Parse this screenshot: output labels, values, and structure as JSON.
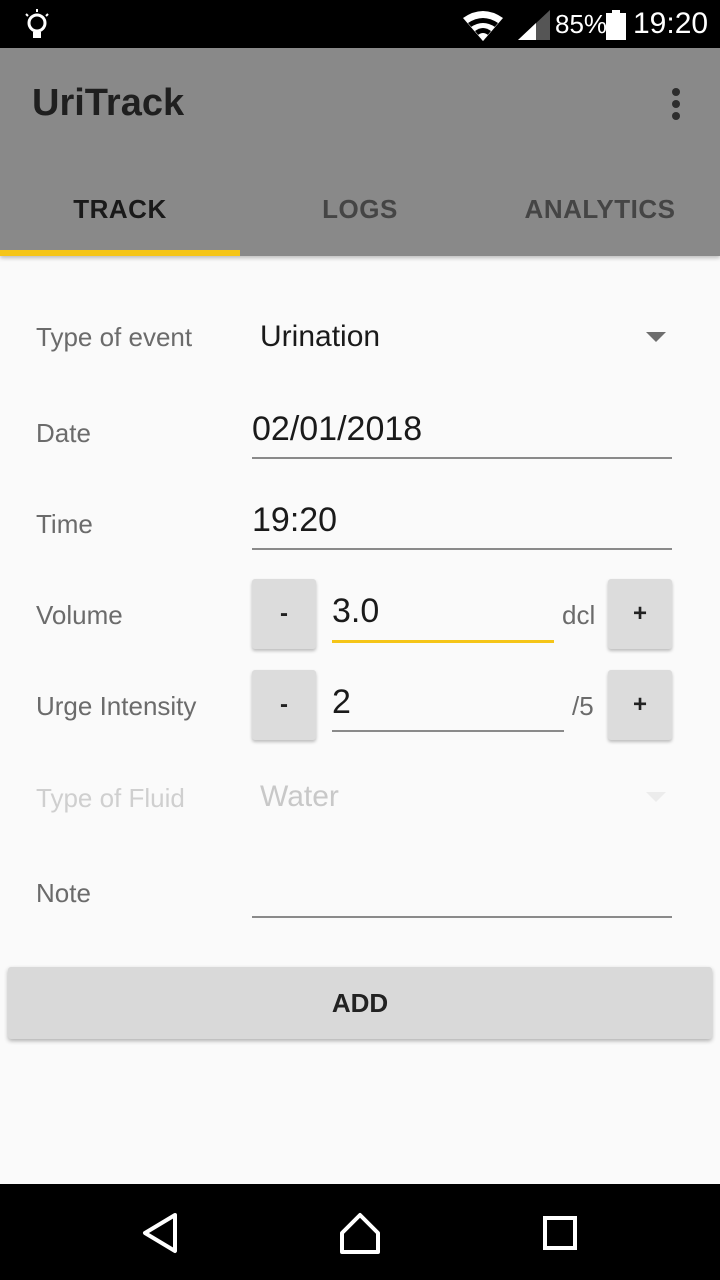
{
  "status_bar": {
    "battery_percent": "85%",
    "time": "19:20",
    "icons": [
      "lightbulb-icon",
      "wifi-icon",
      "signal-icon",
      "battery-icon"
    ]
  },
  "app_bar": {
    "title": "UriTrack",
    "menu_icon": "more-vert-icon",
    "tabs": [
      {
        "label": "TRACK",
        "active": true
      },
      {
        "label": "LOGS",
        "active": false
      },
      {
        "label": "ANALYTICS",
        "active": false
      }
    ],
    "color": "#898989",
    "accent": "#f5c518"
  },
  "form": {
    "type_of_event": {
      "label": "Type of event",
      "value": "Urination"
    },
    "date": {
      "label": "Date",
      "value": "02/01/2018"
    },
    "time": {
      "label": "Time",
      "value": "19:20"
    },
    "volume": {
      "label": "Volume",
      "value": "3.0",
      "unit": "dcl",
      "minus": "-",
      "plus": "+"
    },
    "urge": {
      "label": "Urge Intensity",
      "value": "2",
      "unit": "/5",
      "minus": "-",
      "plus": "+"
    },
    "fluid": {
      "label": "Type of Fluid",
      "value": "Water",
      "disabled": true
    },
    "note": {
      "label": "Note",
      "value": ""
    }
  },
  "add_button": {
    "label": "ADD"
  },
  "nav_bar": {
    "buttons": [
      "back-icon",
      "home-icon",
      "recents-icon"
    ]
  }
}
